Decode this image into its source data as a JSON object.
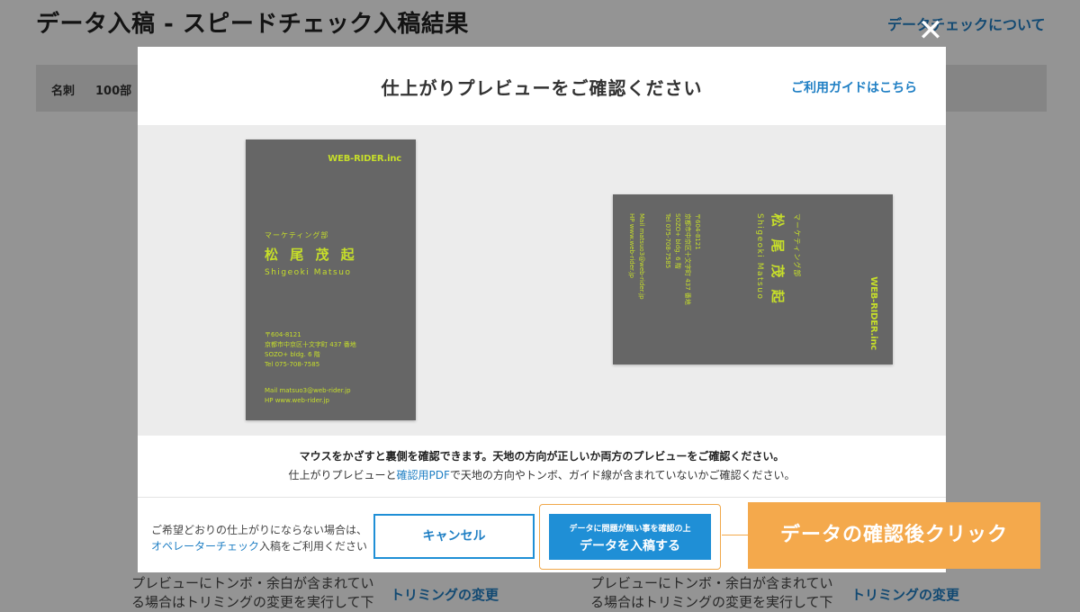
{
  "background": {
    "title": "データ入稿 - スピードチェック入稿結果",
    "top_link": "データチェックについて",
    "bar_name": "名刺",
    "bar_qty": "100部",
    "note": "プレビューにトンボ・余白が含まれている場合はトリミングの変更を実行して下さい",
    "trim_link": "トリミングの変更"
  },
  "modal": {
    "close_symbol": "✕",
    "title": "仕上がりプレビューをご確認ください",
    "guide_link": "ご利用ガイドはこちら",
    "card_front": {
      "logo": "WEB-RIDER.inc",
      "dept": "マーケティング部",
      "name": "松 尾 茂 起",
      "roman": "Shigeoki Matsuo",
      "addr_lines": [
        "〒604-8121",
        "京都市中京区十文字町 437 番地",
        "SOZO+ bldg. 6 階",
        "Tel 075-708-7585"
      ],
      "contact_lines": [
        "Mail matsuo3@web-rider.jp",
        "HP www.web-rider.jp"
      ]
    },
    "message_line1": "マウスをかざすと裏側を確認できます。天地の方向が正しいか両方のプレビューをご確認ください。",
    "message_line2_pre": "仕上がりプレビューと",
    "message_line2_link": "確認用PDF",
    "message_line2_post": "で天地の方向やトンボ、ガイド線が含まれていないかご確認ください。",
    "footer_note_line1": "ご希望どおりの仕上がりにならない場合は、",
    "footer_note_link": "オペレーターチェック",
    "footer_note_line2_post": "入稿をご利用ください",
    "cancel_label": "キャンセル",
    "submit_sub": "データに問題が無い事を確認の上",
    "submit_main": "データを入稿する"
  },
  "callout": {
    "text": "データの確認後クリック"
  },
  "colors": {
    "accent_blue": "#1f8fd6",
    "card_gray": "#666666",
    "card_text": "#c6de2a",
    "callout_orange": "#f4a94c"
  }
}
